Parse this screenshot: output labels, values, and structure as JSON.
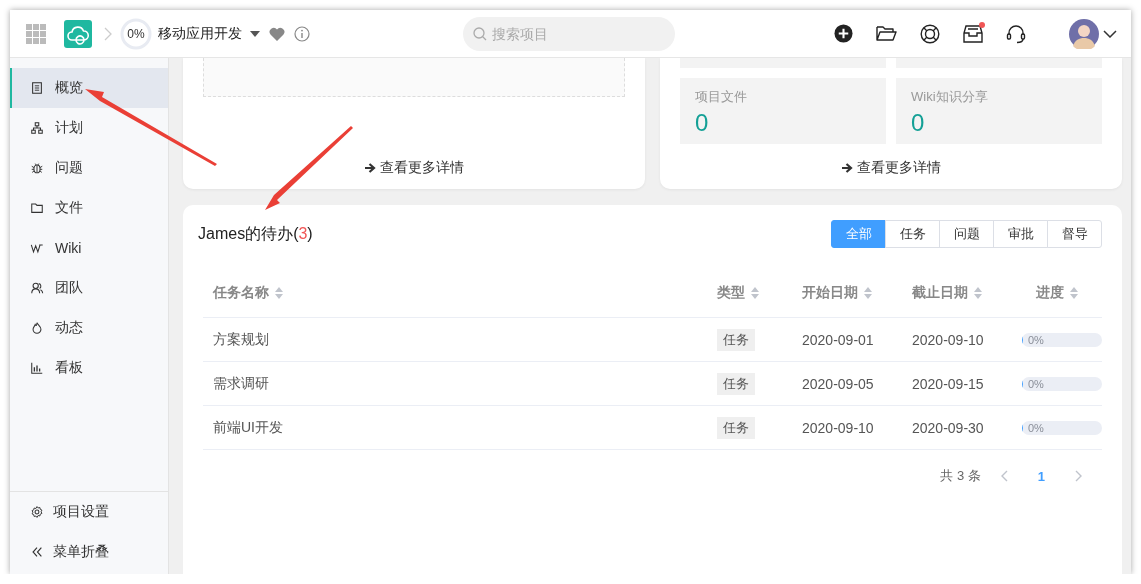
{
  "topbar": {
    "progress": "0%",
    "project": "移动应用开发",
    "search": {
      "placeholder": "搜索项目"
    },
    "inbox_unread": true
  },
  "sidebar": {
    "items": [
      {
        "label": "概览",
        "selected": true
      },
      {
        "label": "计划",
        "selected": false
      },
      {
        "label": "问题",
        "selected": false
      },
      {
        "label": "文件",
        "selected": false
      },
      {
        "label": "Wiki",
        "selected": false
      },
      {
        "label": "团队",
        "selected": false
      },
      {
        "label": "动态",
        "selected": false
      },
      {
        "label": "看板",
        "selected": false
      }
    ],
    "footer": [
      {
        "label": "项目设置"
      },
      {
        "label": "菜单折叠"
      }
    ]
  },
  "summary": {
    "left_link": "查看更多详情",
    "tiles": [
      {
        "label": "项目文件",
        "value": "0"
      },
      {
        "label": "Wiki知识分享",
        "value": "0"
      }
    ],
    "right_link": "查看更多详情"
  },
  "todo": {
    "title": "James的待办(",
    "count": "3",
    "title_end": ")",
    "filters": [
      {
        "label": "全部",
        "selected": true
      },
      {
        "label": "任务",
        "selected": false
      },
      {
        "label": "问题",
        "selected": false
      },
      {
        "label": "审批",
        "selected": false
      },
      {
        "label": "督导",
        "selected": false
      }
    ],
    "columns": [
      "任务名称",
      "类型",
      "开始日期",
      "截止日期",
      "进度"
    ],
    "rows": [
      {
        "name": "方案规划",
        "type": "任务",
        "start": "2020-09-01",
        "end": "2020-09-10",
        "progress": "0%",
        "level": 0
      },
      {
        "name": "需求调研",
        "type": "任务",
        "start": "2020-09-05",
        "end": "2020-09-15",
        "progress": "0%",
        "level": 0
      },
      {
        "name": "前端UI开发",
        "type": "任务",
        "start": "2020-09-10",
        "end": "2020-09-30",
        "progress": "0%",
        "level": 0
      }
    ],
    "pagination": {
      "total": "共 3 条",
      "pages": [
        {
          "label": "1",
          "selected": true
        }
      ]
    }
  }
}
